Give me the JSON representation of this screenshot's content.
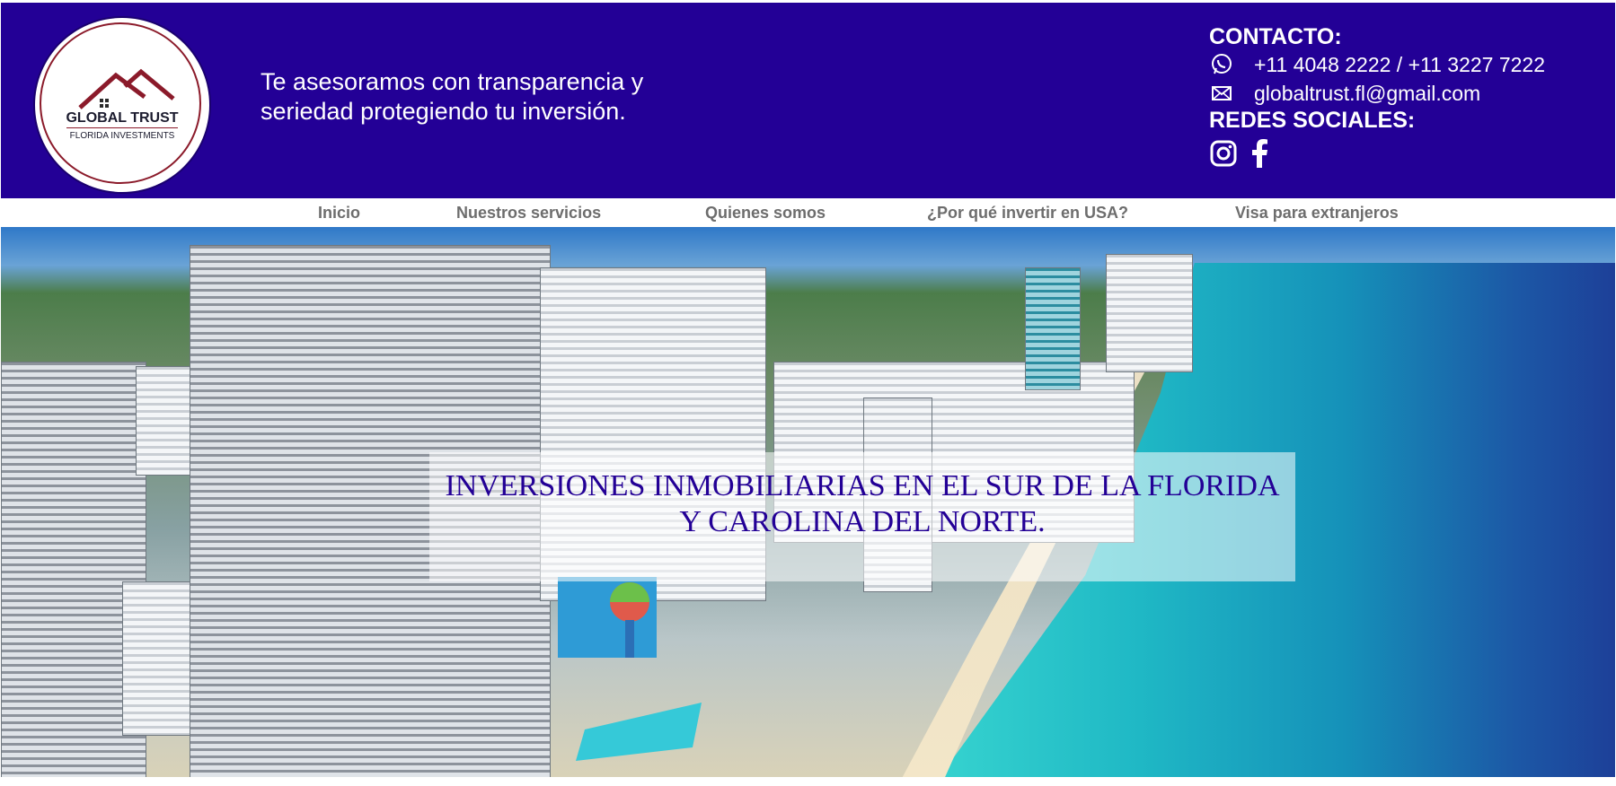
{
  "brand": {
    "name": "GLOBAL TRUST",
    "subtitle": "FLORIDA INVESTMENTS"
  },
  "header": {
    "tagline": "Te asesoramos con transparencia y seriedad protegiendo tu inversión."
  },
  "contact": {
    "title": "CONTACTO:",
    "phone": "+11 4048 2222 / +11 3227 7222",
    "email": "globaltrust.fl@gmail.com",
    "social_title": "REDES SOCIALES:",
    "phone_icon": "whatsapp-icon",
    "email_icon": "email-icon",
    "social_icons": [
      "instagram-icon",
      "facebook-icon"
    ]
  },
  "nav": {
    "items": [
      {
        "label": "Inicio"
      },
      {
        "label": "Nuestros servicios"
      },
      {
        "label": "Quienes somos"
      },
      {
        "label": "¿Por qué invertir en USA?"
      },
      {
        "label": "Visa para extranjeros"
      }
    ]
  },
  "hero": {
    "headline_line1": "INVERSIONES INMOBILIARIAS EN EL SUR DE LA FLORIDA",
    "headline_line2": "Y CAROLINA DEL NORTE."
  },
  "colors": {
    "header_bg": "#230096",
    "nav_text": "#6d6d6d",
    "headline": "#230096",
    "logo_accent": "#8b1a2a"
  }
}
